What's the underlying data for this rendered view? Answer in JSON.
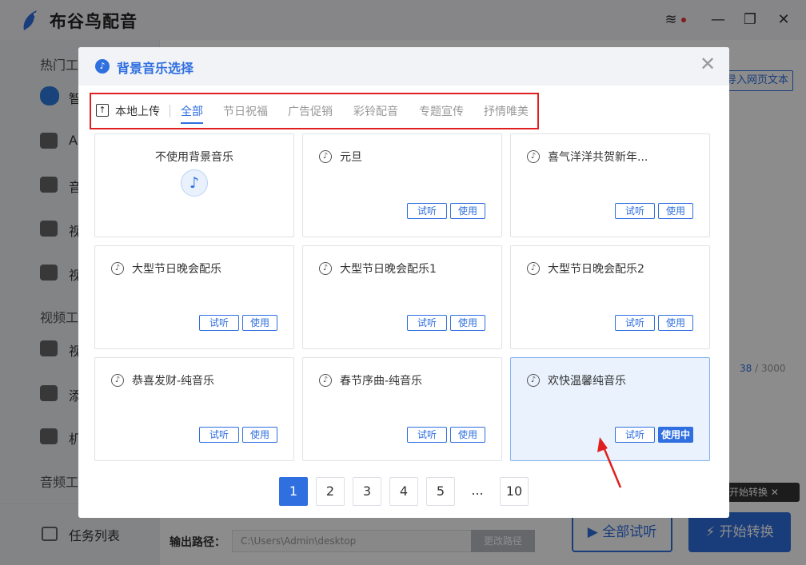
{
  "app": {
    "name": "布谷鸟配音",
    "sidebar_sections": [
      "热门工",
      "视频工",
      "音频工"
    ],
    "sidebar_items": [
      "智",
      "A",
      "音",
      "视",
      "视",
      "视",
      "添",
      "机"
    ],
    "task_list": "任务列表",
    "import_web_text": "导入网页文本",
    "counter_current": "38",
    "counter_total": " / 3000",
    "tooltip": "开始转换",
    "output_label": "输出路径：",
    "output_path": "C:\\Users\\Admin\\desktop",
    "change_path": "更改路径",
    "listen_all": "全部试听",
    "start_convert": "开始转换",
    "brand_color": "#2f6fe0"
  },
  "dialog": {
    "title": "背景音乐选择",
    "upload": "本地上传",
    "tabs": [
      "全部",
      "节日祝福",
      "广告促销",
      "彩铃配音",
      "专题宣传",
      "抒情唯美"
    ],
    "active_tab": "全部",
    "no_music": "不使用背景音乐",
    "listen_label": "试听",
    "use_label": "使用",
    "using_label": "使用中",
    "cards": [
      "元旦",
      "喜气洋洋共贺新年...",
      "大型节日晚会配乐",
      "大型节日晚会配乐1",
      "大型节日晚会配乐2",
      "恭喜发财-纯音乐",
      "春节序曲-纯音乐",
      "欢快温馨纯音乐"
    ],
    "selected_card": "欢快温馨纯音乐",
    "pages": [
      "1",
      "2",
      "3",
      "4",
      "5",
      "...",
      "10"
    ],
    "current_page": "1"
  }
}
